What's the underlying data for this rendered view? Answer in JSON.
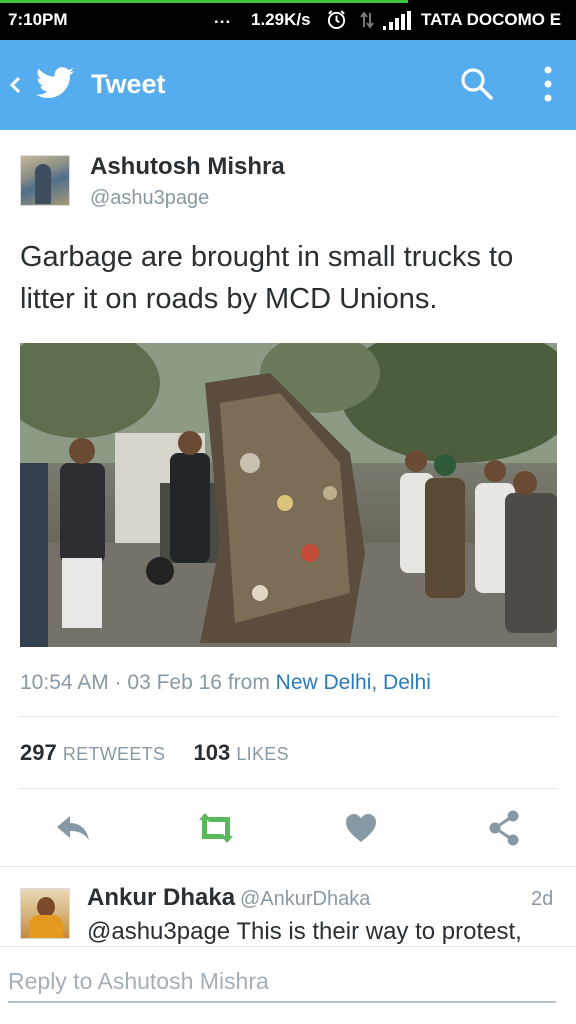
{
  "status_bar": {
    "time": "7:10PM",
    "dots": "...",
    "network_speed": "1.29K/s",
    "carrier": "TATA DOCOMO E",
    "icons": [
      "alarm-icon",
      "data-transfer-icon",
      "signal-icon"
    ]
  },
  "header": {
    "title": "Tweet",
    "color": "#55acee",
    "icons": [
      "back-icon",
      "twitter-bird-icon",
      "search-icon",
      "more-vert-icon"
    ]
  },
  "tweet": {
    "author_name": "Ashutosh Mishra",
    "author_handle": "@ashu3page",
    "text": "Garbage are brought in small trucks to litter it on roads by MCD Unions.",
    "timestamp": "10:54 AM · 03 Feb 16",
    "from_label": "from",
    "location": "New Delhi, Delhi",
    "retweets_count": "297",
    "retweets_label": "RETWEETS",
    "likes_count": "103",
    "likes_label": "LIKES",
    "action_icons": [
      "reply-icon",
      "retweet-icon",
      "heart-icon",
      "share-icon"
    ],
    "retweet_color": "#5cb85c"
  },
  "reply_preview": {
    "name": "Ankur Dhaka",
    "handle": "@AnkurDhaka",
    "time": "2d",
    "text": "@ashu3page This is their way to protest,"
  },
  "composer": {
    "placeholder": "Reply to Ashutosh Mishra"
  }
}
